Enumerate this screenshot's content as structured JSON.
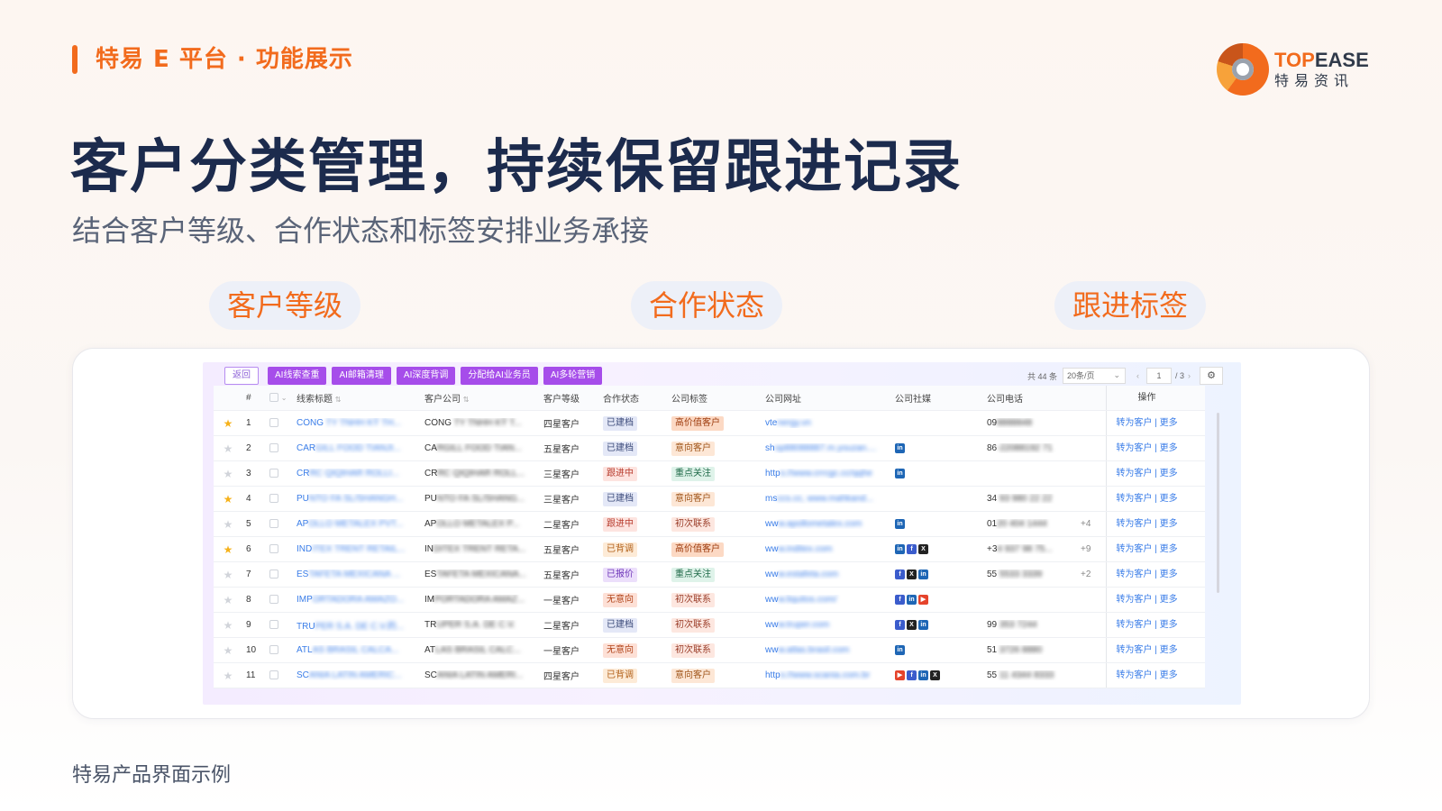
{
  "header": {
    "title": "特易 E 平台 · 功能展示"
  },
  "logo": {
    "brand_en_a": "TOP",
    "brand_en_b": "EASE",
    "brand_cn": "特易资讯"
  },
  "headline": "客户分类管理，持续保留跟进记录",
  "subhead": "结合客户等级、合作状态和标签安排业务承接",
  "pills": [
    "客户等级",
    "合作状态",
    "跟进标签"
  ],
  "toolbar": {
    "back": "返回",
    "actions": [
      "AI线索查重",
      "AI邮箱清理",
      "AI深度背调",
      "分配给AI业务员",
      "AI多轮营销"
    ]
  },
  "pager": {
    "total": "共 44 条",
    "page_size": "20条/页",
    "page": "1",
    "pages": "/ 3"
  },
  "columns": {
    "num": "#",
    "title": "线索标题",
    "company": "客户公司",
    "level": "客户等级",
    "status": "合作状态",
    "tag": "公司标签",
    "url": "公司网址",
    "social": "公司社媒",
    "phone": "公司电话",
    "op": "操作"
  },
  "status_colors": {
    "已建档": {
      "bg": "#e4e8f7",
      "fg": "#3b4a7a"
    },
    "跟进中": {
      "bg": "#fde4e0",
      "fg": "#b73a2c"
    },
    "已背调": {
      "bg": "#fdebd7",
      "fg": "#b2611a"
    },
    "已报价": {
      "bg": "#ecdffb",
      "fg": "#6d34b8"
    },
    "无意向": {
      "bg": "#fde0d6",
      "fg": "#b2461c"
    }
  },
  "tag_colors": {
    "高价值客户": {
      "bg": "#fcd9c4",
      "fg": "#9d3a0b"
    },
    "意向客户": {
      "bg": "#fde7d6",
      "fg": "#a0551a"
    },
    "重点关注": {
      "bg": "#dff3ea",
      "fg": "#1f6a48"
    },
    "初次联系": {
      "bg": "#fde7e0",
      "fg": "#9b3e2a"
    }
  },
  "rows": [
    {
      "n": "1",
      "star": true,
      "title_a": "CÔNG",
      "title_b": " TY TNHH KỸ TH...",
      "co_a": "CÔNG",
      "co_b": " TY TNHH KỸ T...",
      "level": "四星客户",
      "status": "已建档",
      "tag": "高价值客户",
      "url_a": "vte",
      "url_b": "nergy.vn",
      "social": [],
      "phone_a": "09",
      "phone_b": "8888848",
      "extra": "",
      "op_a": "转为客户",
      "op_b": "更多"
    },
    {
      "n": "2",
      "star": false,
      "title_a": "CAR",
      "title_b": "GILL FOOD TIANJI...",
      "co_a": "CA",
      "co_b": "RGILL FOOD TIAN...",
      "level": "五星客户",
      "status": "已建档",
      "tag": "意向客户",
      "url_a": "sh",
      "url_b": "op88088887.m.youzan....",
      "social": [
        "in"
      ],
      "phone_a": "86",
      "phone_b": "-22088192 71",
      "extra": "",
      "op_a": "转为客户",
      "op_b": "更多"
    },
    {
      "n": "3",
      "star": false,
      "title_a": "CR",
      "title_b": "RC QIQIHAR ROLLI...",
      "co_a": "CR",
      "co_b": "RC QIQIHAR ROLL...",
      "level": "三星客户",
      "status": "跟进中",
      "tag": "重点关注",
      "url_a": "http",
      "url_b": "s://www.crrcgc.cc/qqhe",
      "social": [
        "in"
      ],
      "phone_a": "",
      "phone_b": "",
      "extra": "",
      "op_a": "转为客户",
      "op_b": "更多"
    },
    {
      "n": "4",
      "star": true,
      "title_a": "PU",
      "title_b": "NTO FA SL/SHANGH...",
      "co_a": "PU",
      "co_b": "NTO FA SL/SHANG...",
      "level": "三星客户",
      "status": "已建档",
      "tag": "意向客户",
      "url_a": "ms",
      "url_b": "ccs.cc, www.mahkand...",
      "social": [],
      "phone_a": "34",
      "phone_b": " 93 980 22 22",
      "extra": "",
      "op_a": "转为客户",
      "op_b": "更多"
    },
    {
      "n": "5",
      "star": false,
      "title_a": "AP",
      "title_b": "OLLO METALEX PVT...",
      "co_a": "AP",
      "co_b": "OLLO METALEX P...",
      "level": "二星客户",
      "status": "跟进中",
      "tag": "初次联系",
      "url_a": "ww",
      "url_b": "w.apollometalex.com",
      "social": [
        "in"
      ],
      "phone_a": "01",
      "phone_b": "20 404 1444",
      "extra": "+4",
      "op_a": "转为客户",
      "op_b": "更多"
    },
    {
      "n": "6",
      "star": true,
      "title_a": "IND",
      "title_b": "ITEX TRENT RETAIL...",
      "co_a": "IN",
      "co_b": "DITEX TRENT RETA...",
      "level": "五星客户",
      "status": "已背调",
      "tag": "高价值客户",
      "url_a": "ww",
      "url_b": "w.inditex.com",
      "social": [
        "in",
        "fb",
        "x"
      ],
      "phone_a": "+3",
      "phone_b": "4 937 98 75...",
      "extra": "+9",
      "op_a": "转为客户",
      "op_b": "更多"
    },
    {
      "n": "7",
      "star": false,
      "title_a": "ES",
      "title_b": "TAFETA MEXICANA ...",
      "co_a": "ES",
      "co_b": "TAFETA MEXICANA...",
      "level": "五星客户",
      "status": "已报价",
      "tag": "重点关注",
      "url_a": "ww",
      "url_b": "w.estafeta.com",
      "social": [
        "fb",
        "x",
        "in"
      ],
      "phone_a": "55",
      "phone_b": " 5533 3339",
      "extra": "+2",
      "op_a": "转为客户",
      "op_b": "更多"
    },
    {
      "n": "8",
      "star": false,
      "title_a": "IMP",
      "title_b": "ORTADORA AMAZO...",
      "co_a": "IM",
      "co_b": "PORTADORA AMAZ...",
      "level": "一星客户",
      "status": "无意向",
      "tag": "初次联系",
      "url_a": "ww",
      "url_b": "w.liquitos.com/",
      "social": [
        "fb",
        "in",
        "yt"
      ],
      "phone_a": "",
      "phone_b": "",
      "extra": "",
      "op_a": "转为客户",
      "op_b": "更多"
    },
    {
      "n": "9",
      "star": false,
      "title_a": "TRU",
      "title_b": "PER S.A. DE C.V.的...",
      "co_a": "TR",
      "co_b": "UPER S.A. DE C.V.",
      "level": "二星客户",
      "status": "已建档",
      "tag": "初次联系",
      "url_a": "ww",
      "url_b": "w.truper.com",
      "social": [
        "fb",
        "x",
        "in"
      ],
      "phone_a": "99",
      "phone_b": " 353 7244",
      "extra": "",
      "op_a": "转为客户",
      "op_b": "更多"
    },
    {
      "n": "10",
      "star": false,
      "title_a": "ATL",
      "title_b": "AS BRASIL CALCA...",
      "co_a": "AT",
      "co_b": "LAS BRASIL CALC...",
      "level": "一星客户",
      "status": "无意向",
      "tag": "初次联系",
      "url_a": "ww",
      "url_b": "w.atlas.brasil.com",
      "social": [
        "in"
      ],
      "phone_a": "51",
      "phone_b": " 3726 8880",
      "extra": "",
      "op_a": "转为客户",
      "op_b": "更多"
    },
    {
      "n": "11",
      "star": false,
      "title_a": "SC",
      "title_b": "ANIA LATIN AMERIC...",
      "co_a": "SC",
      "co_b": "ANIA LATIN AMERI...",
      "level": "四星客户",
      "status": "已背调",
      "tag": "意向客户",
      "url_a": "http",
      "url_b": "s://www.scania.com.br",
      "social": [
        "yt",
        "fb",
        "in",
        "x"
      ],
      "phone_a": "55",
      "phone_b": " 11 4344 8333",
      "extra": "",
      "op_a": "转为客户",
      "op_b": "更多"
    }
  ],
  "footer": "特易产品界面示例"
}
